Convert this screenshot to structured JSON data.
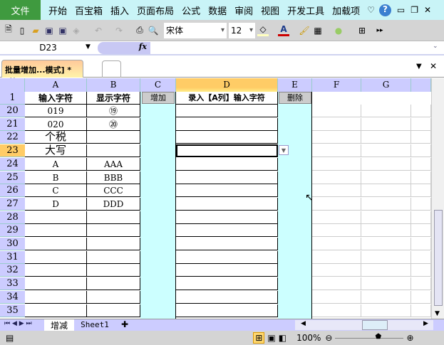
{
  "menu": {
    "file": "文件",
    "items": [
      "开始",
      "百宝箱",
      "插入",
      "页面布局",
      "公式",
      "数据",
      "审阅",
      "视图",
      "开发工具",
      "加载项"
    ]
  },
  "toolbar": {
    "font": "宋体",
    "size": "12"
  },
  "formula": {
    "name_box": "D23",
    "fx": "fx",
    "value": ""
  },
  "doc_tab": {
    "title": "批量增加...模式] *"
  },
  "columns": [
    "A",
    "B",
    "C",
    "D",
    "E",
    "F",
    "G"
  ],
  "header_row": {
    "row": "1",
    "a": "输入字符",
    "b": "显示字符",
    "c_button": "增加",
    "d": "录入【A列】输入字符",
    "e_button": "删除"
  },
  "rows": [
    {
      "n": "20",
      "a": "019",
      "b": "⑲"
    },
    {
      "n": "21",
      "a": "020",
      "b": "⑳"
    },
    {
      "n": "22",
      "a": "个税",
      "b": ""
    },
    {
      "n": "23",
      "a": "大写",
      "b": ""
    },
    {
      "n": "24",
      "a": "A",
      "b": "AAA"
    },
    {
      "n": "25",
      "a": "B",
      "b": "BBB"
    },
    {
      "n": "26",
      "a": "C",
      "b": "CCC"
    },
    {
      "n": "27",
      "a": "D",
      "b": "DDD"
    },
    {
      "n": "28",
      "a": "",
      "b": ""
    },
    {
      "n": "29",
      "a": "",
      "b": ""
    },
    {
      "n": "30",
      "a": "",
      "b": ""
    },
    {
      "n": "31",
      "a": "",
      "b": ""
    },
    {
      "n": "32",
      "a": "",
      "b": ""
    },
    {
      "n": "33",
      "a": "",
      "b": ""
    },
    {
      "n": "34",
      "a": "",
      "b": ""
    },
    {
      "n": "35",
      "a": "",
      "b": ""
    }
  ],
  "sheets": [
    "增减",
    "Sheet1"
  ],
  "status": {
    "zoom": "100%"
  }
}
